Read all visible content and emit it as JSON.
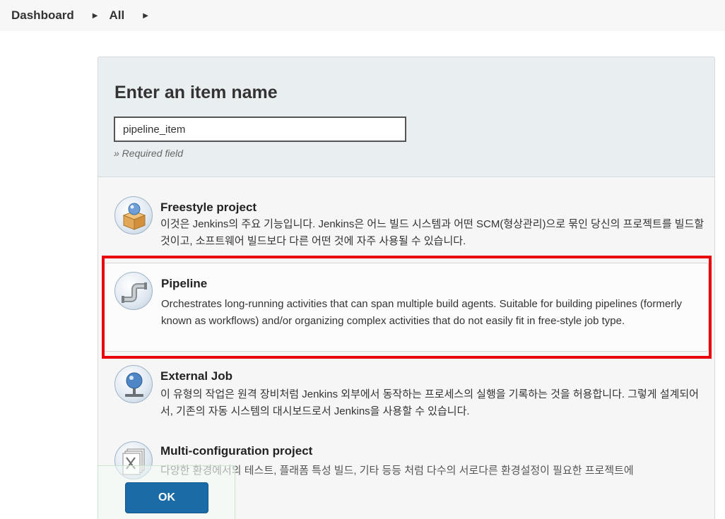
{
  "breadcrumb": {
    "items": [
      {
        "label": "Dashboard"
      },
      {
        "label": "All"
      }
    ]
  },
  "form": {
    "title": "Enter an item name",
    "name_value": "pipeline_item",
    "required_note": "» Required field"
  },
  "item_types": [
    {
      "title": "Freestyle project",
      "description": "이것은 Jenkins의 주요 기능입니다. Jenkins은 어느 빌드 시스템과 어떤 SCM(형상관리)으로 묶인 당신의 프로젝트를 빌드할 것이고, 소프트웨어 빌드보다 다른 어떤 것에 자주 사용될 수 있습니다.",
      "icon": "freestyle-project-icon"
    },
    {
      "title": "Pipeline",
      "description": "Orchestrates long-running activities that can span multiple build agents. Suitable for building pipelines (formerly known as workflows) and/or organizing complex activities that do not easily fit in free-style job type.",
      "icon": "pipeline-icon",
      "selected": true
    },
    {
      "title": "External Job",
      "description": "이 유형의 작업은 원격 장비처럼 Jenkins 외부에서 동작하는 프로세스의 실행을 기록하는 것을 허용합니다. 그렇게 설계되어서, 기존의 자동 시스템의 대시보드로서 Jenkins을 사용할 수 있습니다.",
      "icon": "external-job-icon"
    },
    {
      "title": "Multi-configuration project",
      "description": "다양한 환경에서의 테스트, 플래폼 특성 빌드, 기타 등등 처럼 다수의 서로다른 환경설정이 필요한 프로젝트에",
      "icon": "multi-configuration-icon"
    }
  ],
  "footer": {
    "ok_label": "OK"
  },
  "colors": {
    "highlight": "#e8000c",
    "ok_button": "#1a6ba6",
    "header_bg": "#e9eef0"
  }
}
